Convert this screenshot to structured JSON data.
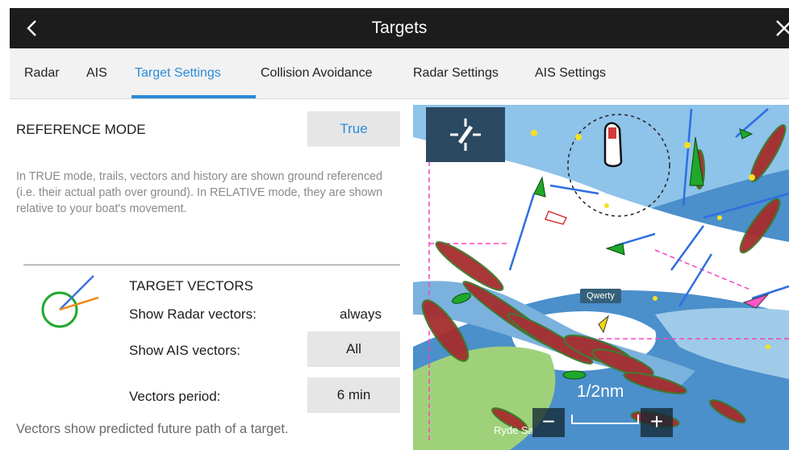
{
  "header": {
    "title": "Targets",
    "back_icon": "back-icon",
    "close_icon": "close-icon"
  },
  "tabs": [
    {
      "label": "Radar"
    },
    {
      "label": "AIS"
    },
    {
      "label": "Target Settings",
      "active": true
    },
    {
      "label": "Collision Avoidance"
    },
    {
      "label": "Radar Settings"
    },
    {
      "label": "AIS Settings"
    }
  ],
  "reference_mode": {
    "label": "REFERENCE MODE",
    "value": "True",
    "description": "In TRUE mode, trails, vectors and history are shown ground referenced (i.e. their actual path over ground). In RELATIVE mode, they are shown relative to your boat's movement."
  },
  "target_vectors": {
    "heading": "TARGET VECTORS",
    "icon": "target-vectors-icon",
    "radar_vectors_label": "Show Radar vectors:",
    "radar_vectors_value": "always",
    "ais_vectors_label": "Show AIS vectors:",
    "ais_vectors_value": "All",
    "period_label": "Vectors period:",
    "period_value": "6 min",
    "footer": "Vectors show predicted future path of a target."
  },
  "map": {
    "scale": "1/2nm",
    "zoom_out": "−",
    "zoom_in": "+",
    "target_label": "Qwerty",
    "place_label": "Ryde Sa",
    "center_icon": "position-center-icon"
  },
  "colors": {
    "accent": "#2a8bd6",
    "header_bg": "#1c1c1c",
    "tabbar_bg": "#f2f2f2",
    "button_bg": "#e6e6e6",
    "vector_green": "#1fa82b",
    "vector_blue": "#3f6fe0",
    "vector_orange": "#f08a1c"
  }
}
